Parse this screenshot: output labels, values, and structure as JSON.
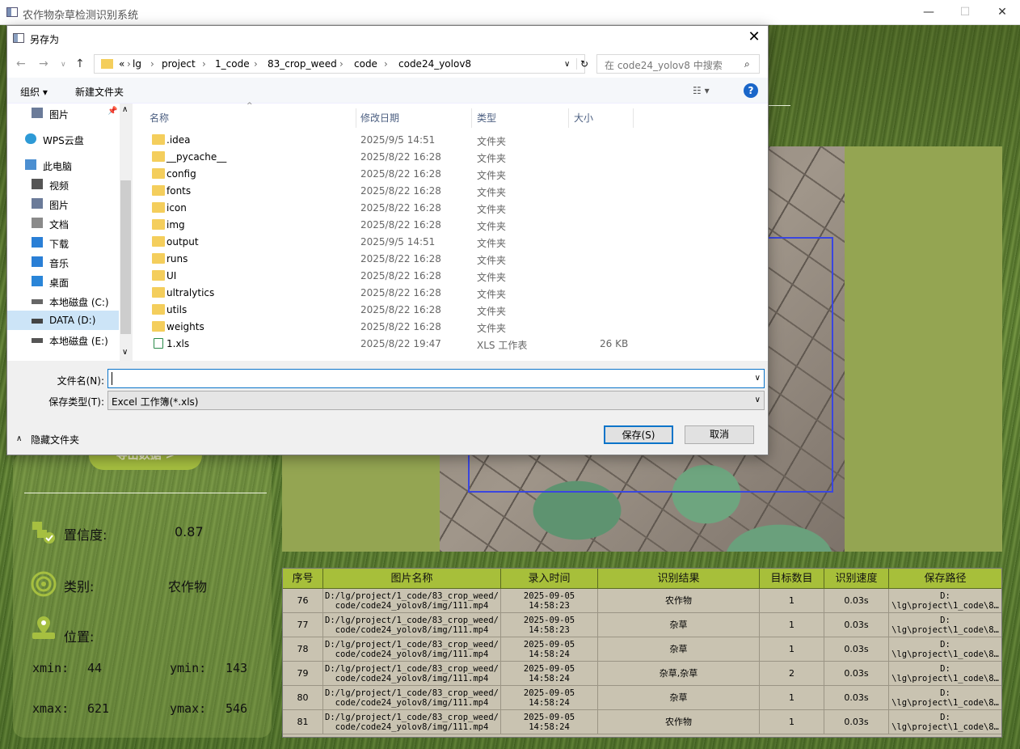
{
  "app": {
    "title": "农作物杂草检测识别系统"
  },
  "left_panel": {
    "export_label": "导出数据 >",
    "confidence_label": "置信度:",
    "confidence_value": "0.87",
    "class_label": "类别:",
    "class_value": "农作物",
    "position_label": "位置:",
    "xmin_label": "xmin:",
    "xmin_value": "44",
    "ymin_label": "ymin:",
    "ymin_value": "143",
    "xmax_label": "xmax:",
    "xmax_value": "621",
    "ymax_label": "ymax:",
    "ymax_value": "546"
  },
  "table": {
    "headers": [
      "序号",
      "图片名称",
      "录入时间",
      "识别结果",
      "目标数目",
      "识别速度",
      "保存路径"
    ],
    "rows": [
      {
        "id": "76",
        "name": "D:/lg/project/1_code/83_crop_weed/\ncode/code24_yolov8/img/111.mp4",
        "time": "2025-09-05\n14:58:23",
        "result": "农作物",
        "count": "1",
        "speed": "0.03s",
        "path": "D:\n\\lg\\project\\1_code\\8…"
      },
      {
        "id": "77",
        "name": "D:/lg/project/1_code/83_crop_weed/\ncode/code24_yolov8/img/111.mp4",
        "time": "2025-09-05\n14:58:23",
        "result": "杂草",
        "count": "1",
        "speed": "0.03s",
        "path": "D:\n\\lg\\project\\1_code\\8…"
      },
      {
        "id": "78",
        "name": "D:/lg/project/1_code/83_crop_weed/\ncode/code24_yolov8/img/111.mp4",
        "time": "2025-09-05\n14:58:24",
        "result": "杂草",
        "count": "1",
        "speed": "0.03s",
        "path": "D:\n\\lg\\project\\1_code\\8…"
      },
      {
        "id": "79",
        "name": "D:/lg/project/1_code/83_crop_weed/\ncode/code24_yolov8/img/111.mp4",
        "time": "2025-09-05\n14:58:24",
        "result": "杂草,杂草",
        "count": "2",
        "speed": "0.03s",
        "path": "D:\n\\lg\\project\\1_code\\8…"
      },
      {
        "id": "80",
        "name": "D:/lg/project/1_code/83_crop_weed/\ncode/code24_yolov8/img/111.mp4",
        "time": "2025-09-05\n14:58:24",
        "result": "杂草",
        "count": "1",
        "speed": "0.03s",
        "path": "D:\n\\lg\\project\\1_code\\8…"
      },
      {
        "id": "81",
        "name": "D:/lg/project/1_code/83_crop_weed/\ncode/code24_yolov8/img/111.mp4",
        "time": "2025-09-05\n14:58:24",
        "result": "农作物",
        "count": "1",
        "speed": "0.03s",
        "path": "D:\n\\lg\\project\\1_code\\8…"
      }
    ]
  },
  "dialog": {
    "title": "另存为",
    "breadcrumbs": [
      "«",
      "lg",
      "project",
      "1_code",
      "83_crop_weed",
      "code",
      "code24_yolov8"
    ],
    "search_placeholder": "在 code24_yolov8 中搜索",
    "organize_label": "组织 ▾",
    "new_folder_label": "新建文件夹",
    "nav_items": [
      "图片",
      "WPS云盘",
      "此电脑",
      "视频",
      "图片",
      "文档",
      "下载",
      "音乐",
      "桌面",
      "本地磁盘 (C:)",
      "DATA (D:)",
      "本地磁盘 (E:)"
    ],
    "columns": [
      "名称",
      "修改日期",
      "类型",
      "大小"
    ],
    "files": [
      {
        "name": ".idea",
        "date": "2025/9/5 14:51",
        "type": "文件夹",
        "size": ""
      },
      {
        "name": "__pycache__",
        "date": "2025/8/22 16:28",
        "type": "文件夹",
        "size": ""
      },
      {
        "name": "config",
        "date": "2025/8/22 16:28",
        "type": "文件夹",
        "size": ""
      },
      {
        "name": "fonts",
        "date": "2025/8/22 16:28",
        "type": "文件夹",
        "size": ""
      },
      {
        "name": "icon",
        "date": "2025/8/22 16:28",
        "type": "文件夹",
        "size": ""
      },
      {
        "name": "img",
        "date": "2025/8/22 16:28",
        "type": "文件夹",
        "size": ""
      },
      {
        "name": "output",
        "date": "2025/9/5 14:51",
        "type": "文件夹",
        "size": ""
      },
      {
        "name": "runs",
        "date": "2025/8/22 16:28",
        "type": "文件夹",
        "size": ""
      },
      {
        "name": "UI",
        "date": "2025/8/22 16:28",
        "type": "文件夹",
        "size": ""
      },
      {
        "name": "ultralytics",
        "date": "2025/8/22 16:28",
        "type": "文件夹",
        "size": ""
      },
      {
        "name": "utils",
        "date": "2025/8/22 16:28",
        "type": "文件夹",
        "size": ""
      },
      {
        "name": "weights",
        "date": "2025/8/22 16:28",
        "type": "文件夹",
        "size": ""
      },
      {
        "name": "1.xls",
        "date": "2025/8/22 19:47",
        "type": "XLS 工作表",
        "size": "26 KB"
      }
    ],
    "filename_label": "文件名(N):",
    "filename_value": "",
    "filetype_label": "保存类型(T):",
    "filetype_value": "Excel 工作簿(*.xls)",
    "hide_folders_label": "隐藏文件夹",
    "save_label": "保存(S)",
    "cancel_label": "取消"
  }
}
